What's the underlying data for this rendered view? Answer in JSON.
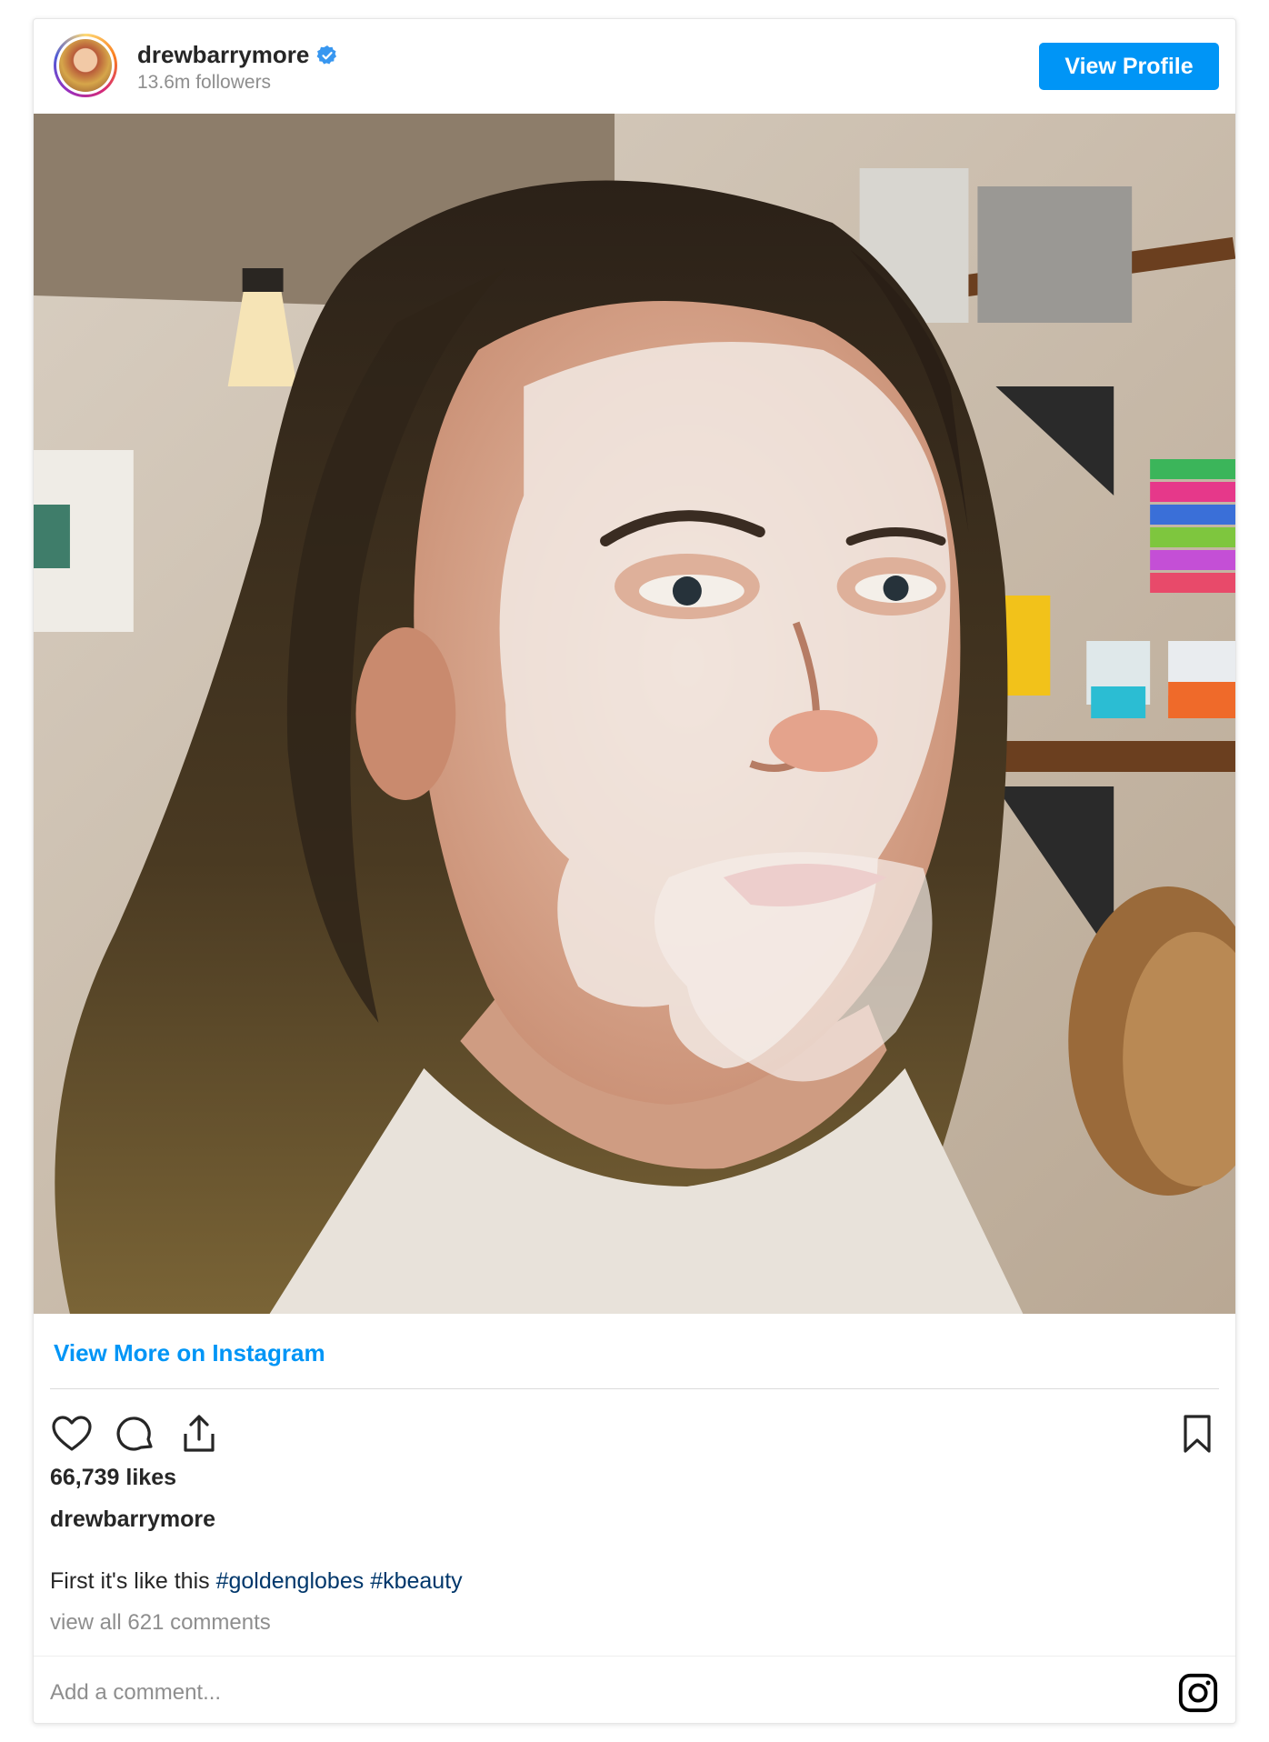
{
  "header": {
    "username": "drewbarrymore",
    "followers": "13.6m followers",
    "view_profile_label": "View Profile"
  },
  "post": {
    "view_more_label": "View More on Instagram",
    "likes": "66,739 likes",
    "author": "drewbarrymore",
    "caption_text": "First it's like this ",
    "hashtags": [
      "#goldenglobes",
      "#kbeauty"
    ],
    "view_comments": "view all 621 comments",
    "comment_placeholder": "Add a comment..."
  },
  "icons": {
    "verified": "verified-badge-icon",
    "like": "heart-icon",
    "comment": "comment-icon",
    "share": "share-icon",
    "save": "bookmark-icon",
    "brand": "instagram-logo-icon"
  },
  "colors": {
    "accent": "#0095f6",
    "hashtag": "#00376b",
    "muted": "#8e8e8e",
    "text": "#262626"
  }
}
